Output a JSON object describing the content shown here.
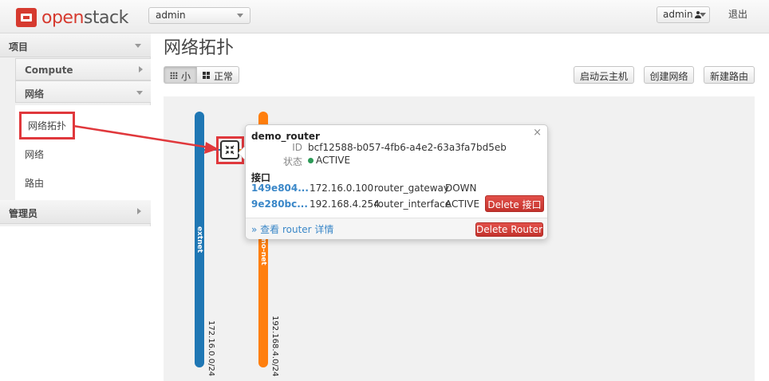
{
  "topbar": {
    "logo_open": "open",
    "logo_stack": "stack",
    "project": "admin",
    "user": "admin",
    "logout": "退出"
  },
  "sidebar": {
    "project_header": "项目",
    "compute": "Compute",
    "network_group": "网络",
    "items": [
      {
        "label": "网络拓扑",
        "active": true
      },
      {
        "label": "网络"
      },
      {
        "label": "路由"
      }
    ],
    "admin_header": "管理员"
  },
  "main": {
    "title": "网络拓扑",
    "view_small": "小",
    "view_normal": "正常",
    "buttons": {
      "launch_instance": "启动云主机",
      "create_network": "创建网络",
      "create_router": "新建路由"
    }
  },
  "topology": {
    "networks": [
      {
        "name": "extnet",
        "cidr": "172.16.0.0/24",
        "color": "#1f77b4"
      },
      {
        "name": "demo-net",
        "cidr": "192.168.4.0/24",
        "color": "#ff7f0e"
      }
    ],
    "router": {
      "name": "demo_router",
      "id_label": "ID",
      "id": "bcf12588-b057-4fb6-a4e2-63a3fa7bd5eb",
      "status_label": "状态",
      "status": "ACTIVE",
      "interfaces_label": "接口",
      "interfaces": [
        {
          "id": "149e804...",
          "ip": "172.16.0.100",
          "type": "router_gateway",
          "status": "DOWN"
        },
        {
          "id": "9e280bc...",
          "ip": "192.168.4.254",
          "type": "router_interface",
          "status": "ACTIVE",
          "delete_label": "Delete 接口"
        }
      ],
      "detail_link": "» 查看 router 详情",
      "delete_router": "Delete Router",
      "close": "×"
    }
  },
  "colors": {
    "accent_red": "#e0383c",
    "extnet_blue": "#1f77b4",
    "demonet_orange": "#ff7f0e",
    "link_blue": "#3a87c8"
  }
}
